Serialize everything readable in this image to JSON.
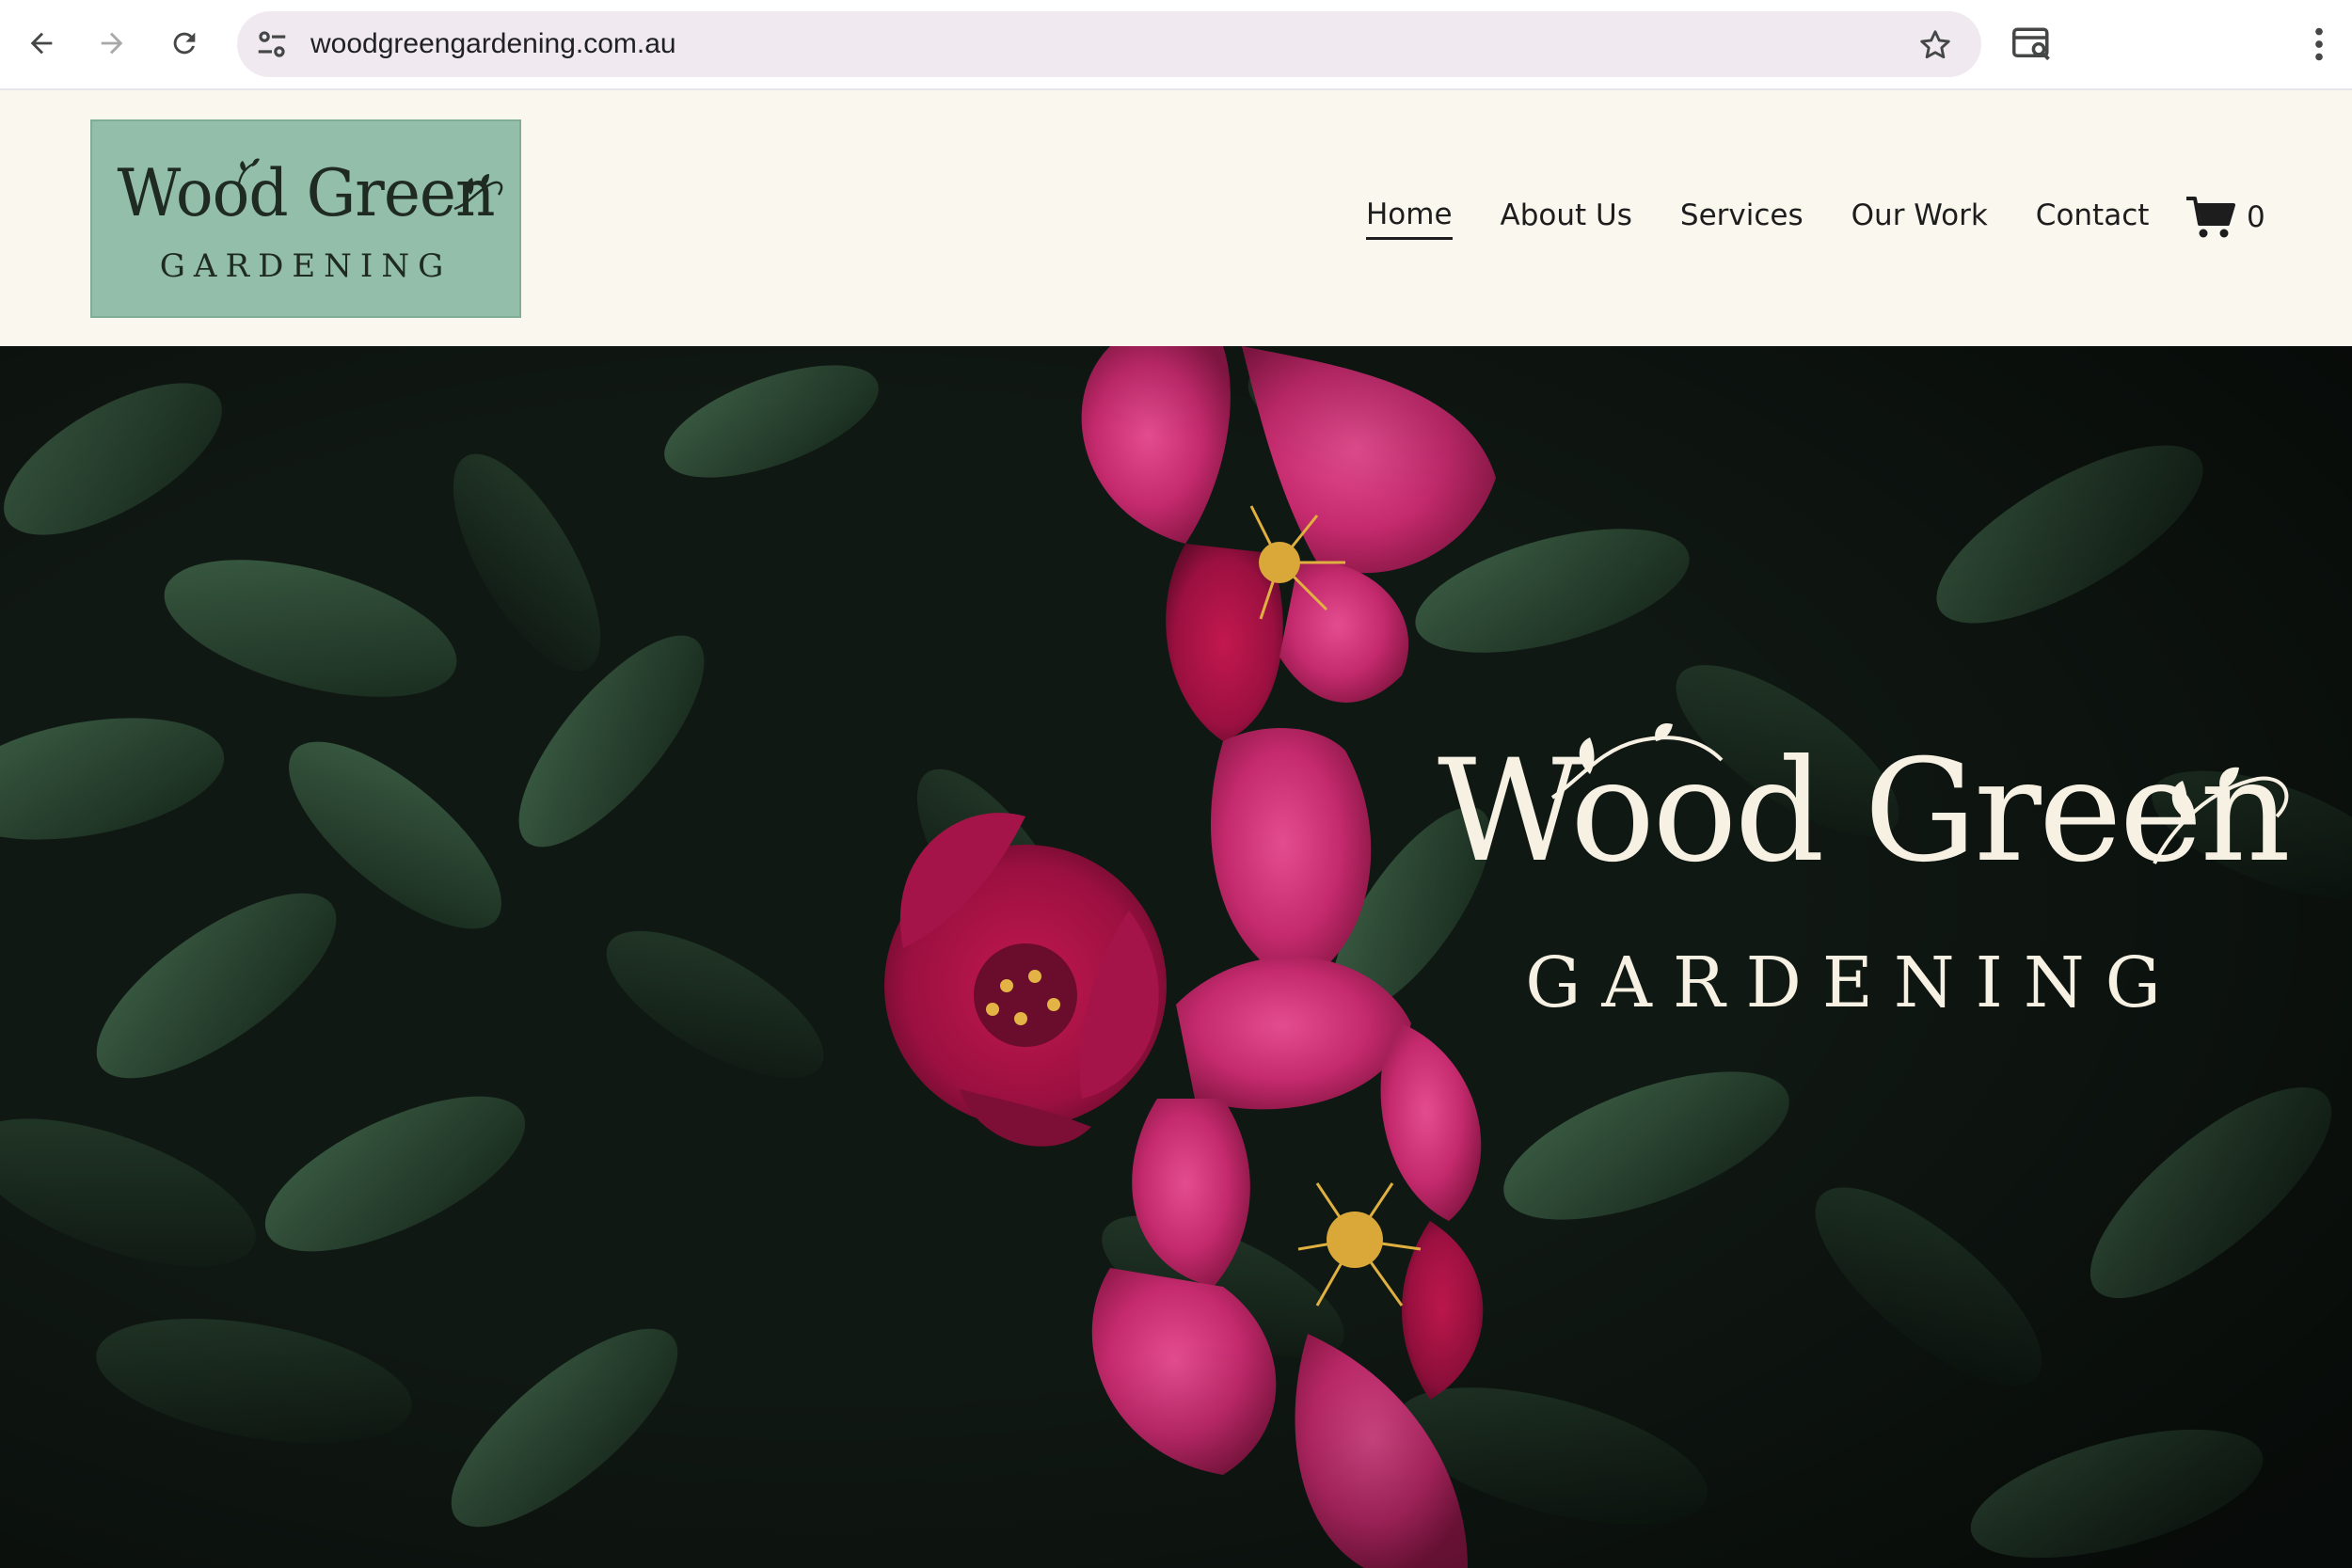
{
  "browser": {
    "url": "woodgreengardening.com.au"
  },
  "site": {
    "logo": {
      "line1": "Wood Green",
      "line2": "GARDENING"
    },
    "nav": [
      {
        "label": "Home",
        "active": true
      },
      {
        "label": "About Us",
        "active": false
      },
      {
        "label": "Services",
        "active": false
      },
      {
        "label": "Our Work",
        "active": false
      },
      {
        "label": "Contact",
        "active": false
      }
    ],
    "cart": {
      "count": "0",
      "icon": "cart-icon"
    }
  },
  "hero": {
    "title": "Wood Green",
    "subtitle": "GARDENING"
  },
  "colors": {
    "header_bg": "#f9f7ee",
    "logo_bg": "#93bfaa",
    "hero_text": "#f7f1e4",
    "omnibox_bg": "#f1e9f0"
  }
}
